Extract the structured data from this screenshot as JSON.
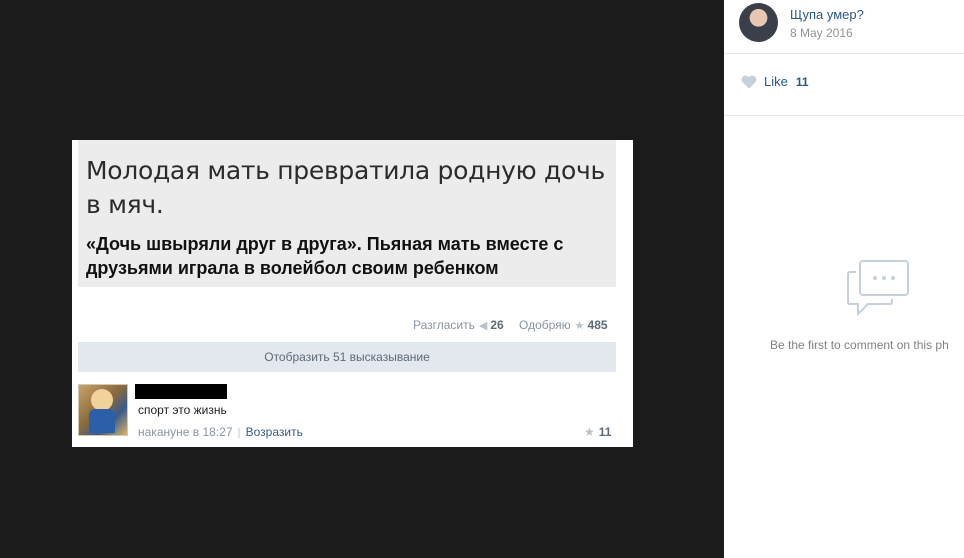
{
  "photo": {
    "headline": "Молодая мать превратила родную дочь в мяч.",
    "subheadline": "«Дочь швыряли друг в друга». Пьяная мать вместе с друзьями играла в волейбол своим ребенком",
    "dislike_label": "Разгласить",
    "dislike_count": "26",
    "like_label": "Одобряю",
    "like_count": "485",
    "show_comments_label": "Отобразить 51 высказывание",
    "comment": {
      "text": "спорт это жизнь",
      "time": "накануне в 18:27",
      "reply_label": "Возразить",
      "likes": "11"
    }
  },
  "panel": {
    "author_name": "Щупа умер?",
    "date": "8 May 2016",
    "like_label": "Like",
    "like_count": "11",
    "empty_comments_text": "Be the first to comment on this ph"
  },
  "colors": {
    "viewer_bg": "#1b1b1b",
    "link": "#2a5885",
    "headline_bg": "#ececec"
  }
}
